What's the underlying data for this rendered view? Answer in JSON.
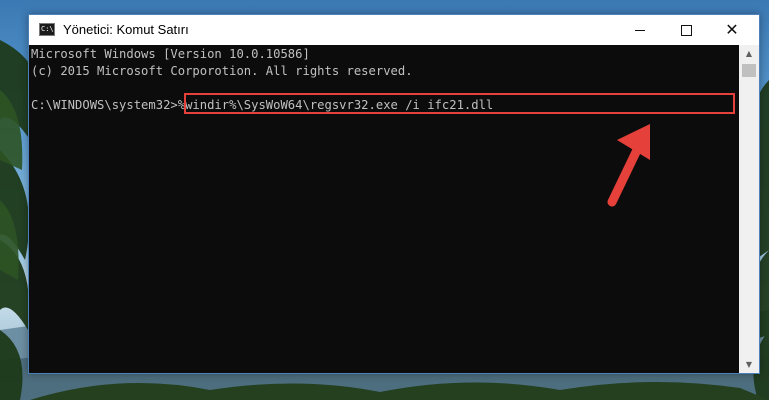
{
  "window": {
    "title": "Yönetici: Komut Satırı",
    "icon_text": "C:\\",
    "controls": {
      "minimize": "minimize",
      "maximize": "maximize",
      "close": "✕"
    }
  },
  "console": {
    "lines": [
      "Microsoft Windows [Version 10.0.10586]",
      "(c) 2015 Microsoft Corporotion. All rights reserved."
    ],
    "prompt": "C:\\WINDOWS\\system32>",
    "command": "%windir%\\SysWoW64\\regsvr32.exe /i ifc21.dll"
  },
  "scrollbar": {
    "up_glyph": "▲",
    "down_glyph": "▼"
  },
  "annotation": {
    "highlight_color": "#e5403a",
    "arrow_color": "#e5403a"
  }
}
